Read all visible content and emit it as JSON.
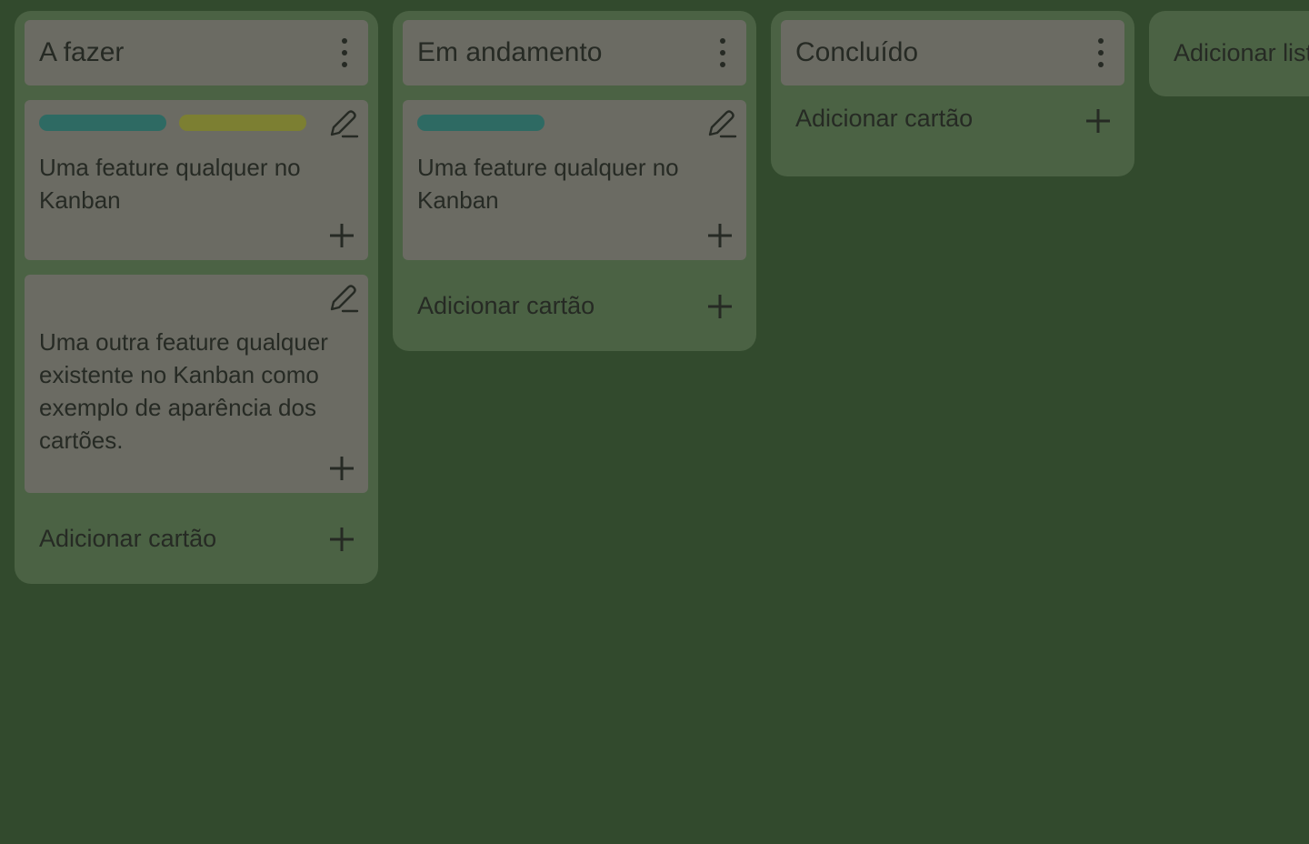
{
  "colors": {
    "background": "#324a2d",
    "list_background": "#4b6244",
    "card_background": "#6b6b63",
    "text": "#262a24",
    "tag_teal": "#2e6a63",
    "tag_olive": "#7c7f32"
  },
  "lists": [
    {
      "title": "A fazer",
      "cards": [
        {
          "tags": [
            "#2e6a63",
            "#7c7f32"
          ],
          "text": "Uma feature qualquer no Kanban"
        },
        {
          "tags": [],
          "text": "Uma outra feature qualquer existente no Kanban como exemplo de aparência dos cartões."
        }
      ],
      "add_card_label": "Adicionar cartão"
    },
    {
      "title": "Em andamento",
      "cards": [
        {
          "tags": [
            "#2e6a63"
          ],
          "text": "Uma feature qualquer no Kanban"
        }
      ],
      "add_card_label": "Adicionar cartão"
    },
    {
      "title": "Concluído",
      "cards": [],
      "add_card_label": "Adicionar cartão"
    }
  ],
  "add_list_label": "Adicionar lista"
}
